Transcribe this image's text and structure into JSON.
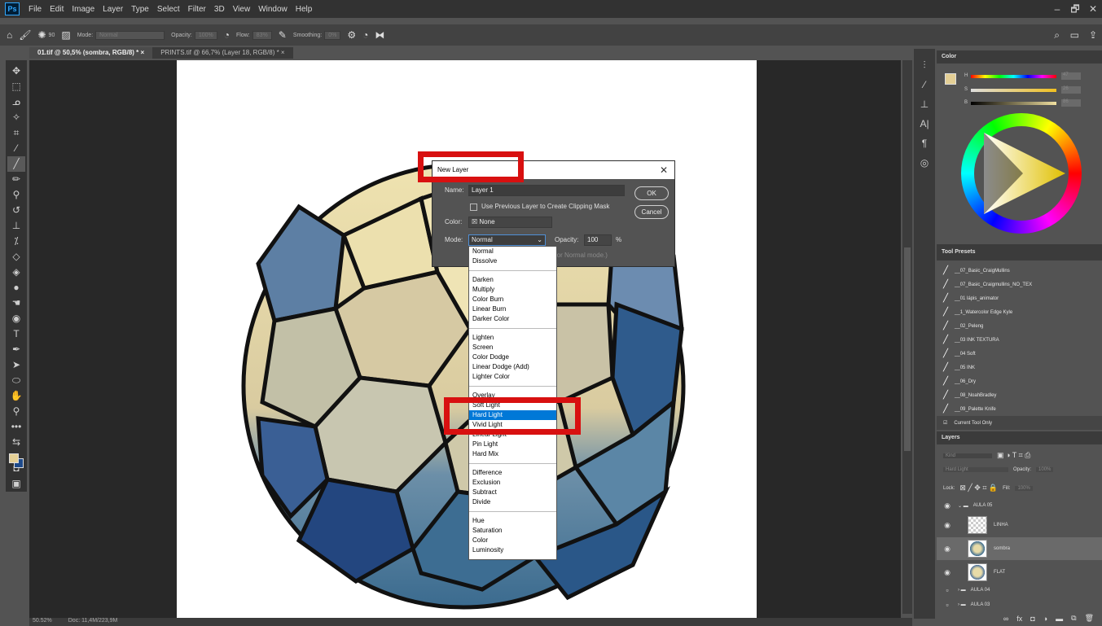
{
  "app": {
    "logo": "Ps",
    "menus": [
      "File",
      "Edit",
      "Image",
      "Layer",
      "Type",
      "Select",
      "Filter",
      "3D",
      "View",
      "Window",
      "Help"
    ],
    "window_controls": [
      "–",
      "🗗",
      "✕"
    ]
  },
  "options": {
    "brush_size": "90",
    "mode_label": "Mode:",
    "mode_value": "Normal",
    "opacity_label": "Opacity:",
    "opacity_value": "100%",
    "flow_label": "Flow:",
    "flow_value": "83%",
    "smoothing_label": "Smoothing:",
    "smoothing_value": "0%"
  },
  "tabs": [
    "01.tif @ 50,5% (sombra, RGB/8) * ×",
    "PRINTS.tif @ 66,7% (Layer 18, RGB/8) * ×"
  ],
  "status": {
    "zoom": "50.52%",
    "doc": "Doc: 11,4M/223,9M"
  },
  "color_panel": {
    "title": "Color",
    "h_label": "H",
    "s_label": "S",
    "b_label": "B",
    "h": "47",
    "s": "26",
    "b": "86",
    "foreground": "#e4cf95",
    "background": "#1e4a8a"
  },
  "tool_presets": {
    "title": "Tool Presets",
    "items": [
      "__07_Basic_CraigMullins",
      "__07_Basic_Craigmullins_NO_TEX",
      "__01 lápis_animator",
      "__1_Watercolor Edge Kyle",
      "__02_Peleng",
      "__03 INK TEXTURA",
      "__04 Soft",
      "__05 INK",
      "__06_Dry",
      "__08_NoahBradley",
      "__09_Palette Knife"
    ],
    "current_only": "Current Tool Only"
  },
  "layers": {
    "title": "Layers",
    "kind": "Kind",
    "blend": "Hard Light",
    "opacity_label": "Opacity:",
    "opacity": "100%",
    "lock_label": "Lock:",
    "fill_label": "Fill:",
    "fill": "100%",
    "items": [
      "AULA 05",
      "LINHA",
      "sombra",
      "FLAT",
      "AULA 04",
      "AULA 03"
    ]
  },
  "dialog": {
    "title": "New Layer",
    "name_label": "Name:",
    "name_value": "Layer 1",
    "clip_label": "Use Previous Layer to Create Clipping Mask",
    "color_label": "Color:",
    "color_value": "None",
    "mode_label": "Mode:",
    "mode_value": "Normal",
    "opacity_label": "Opacity:",
    "opacity_value": "100",
    "percent": "%",
    "ok": "OK",
    "cancel": "Cancel",
    "hint": "(or Normal mode.)"
  },
  "blend_modes": [
    [
      "Normal",
      "Dissolve"
    ],
    [
      "Darken",
      "Multiply",
      "Color Burn",
      "Linear Burn",
      "Darker Color"
    ],
    [
      "Lighten",
      "Screen",
      "Color Dodge",
      "Linear Dodge (Add)",
      "Lighter Color"
    ],
    [
      "Overlay",
      "Soft Light",
      "Hard Light",
      "Vivid Light",
      "Linear Light",
      "Pin Light",
      "Hard Mix"
    ],
    [
      "Difference",
      "Exclusion",
      "Subtract",
      "Divide"
    ],
    [
      "Hue",
      "Saturation",
      "Color",
      "Luminosity"
    ]
  ],
  "selected_mode": "Hard Light"
}
